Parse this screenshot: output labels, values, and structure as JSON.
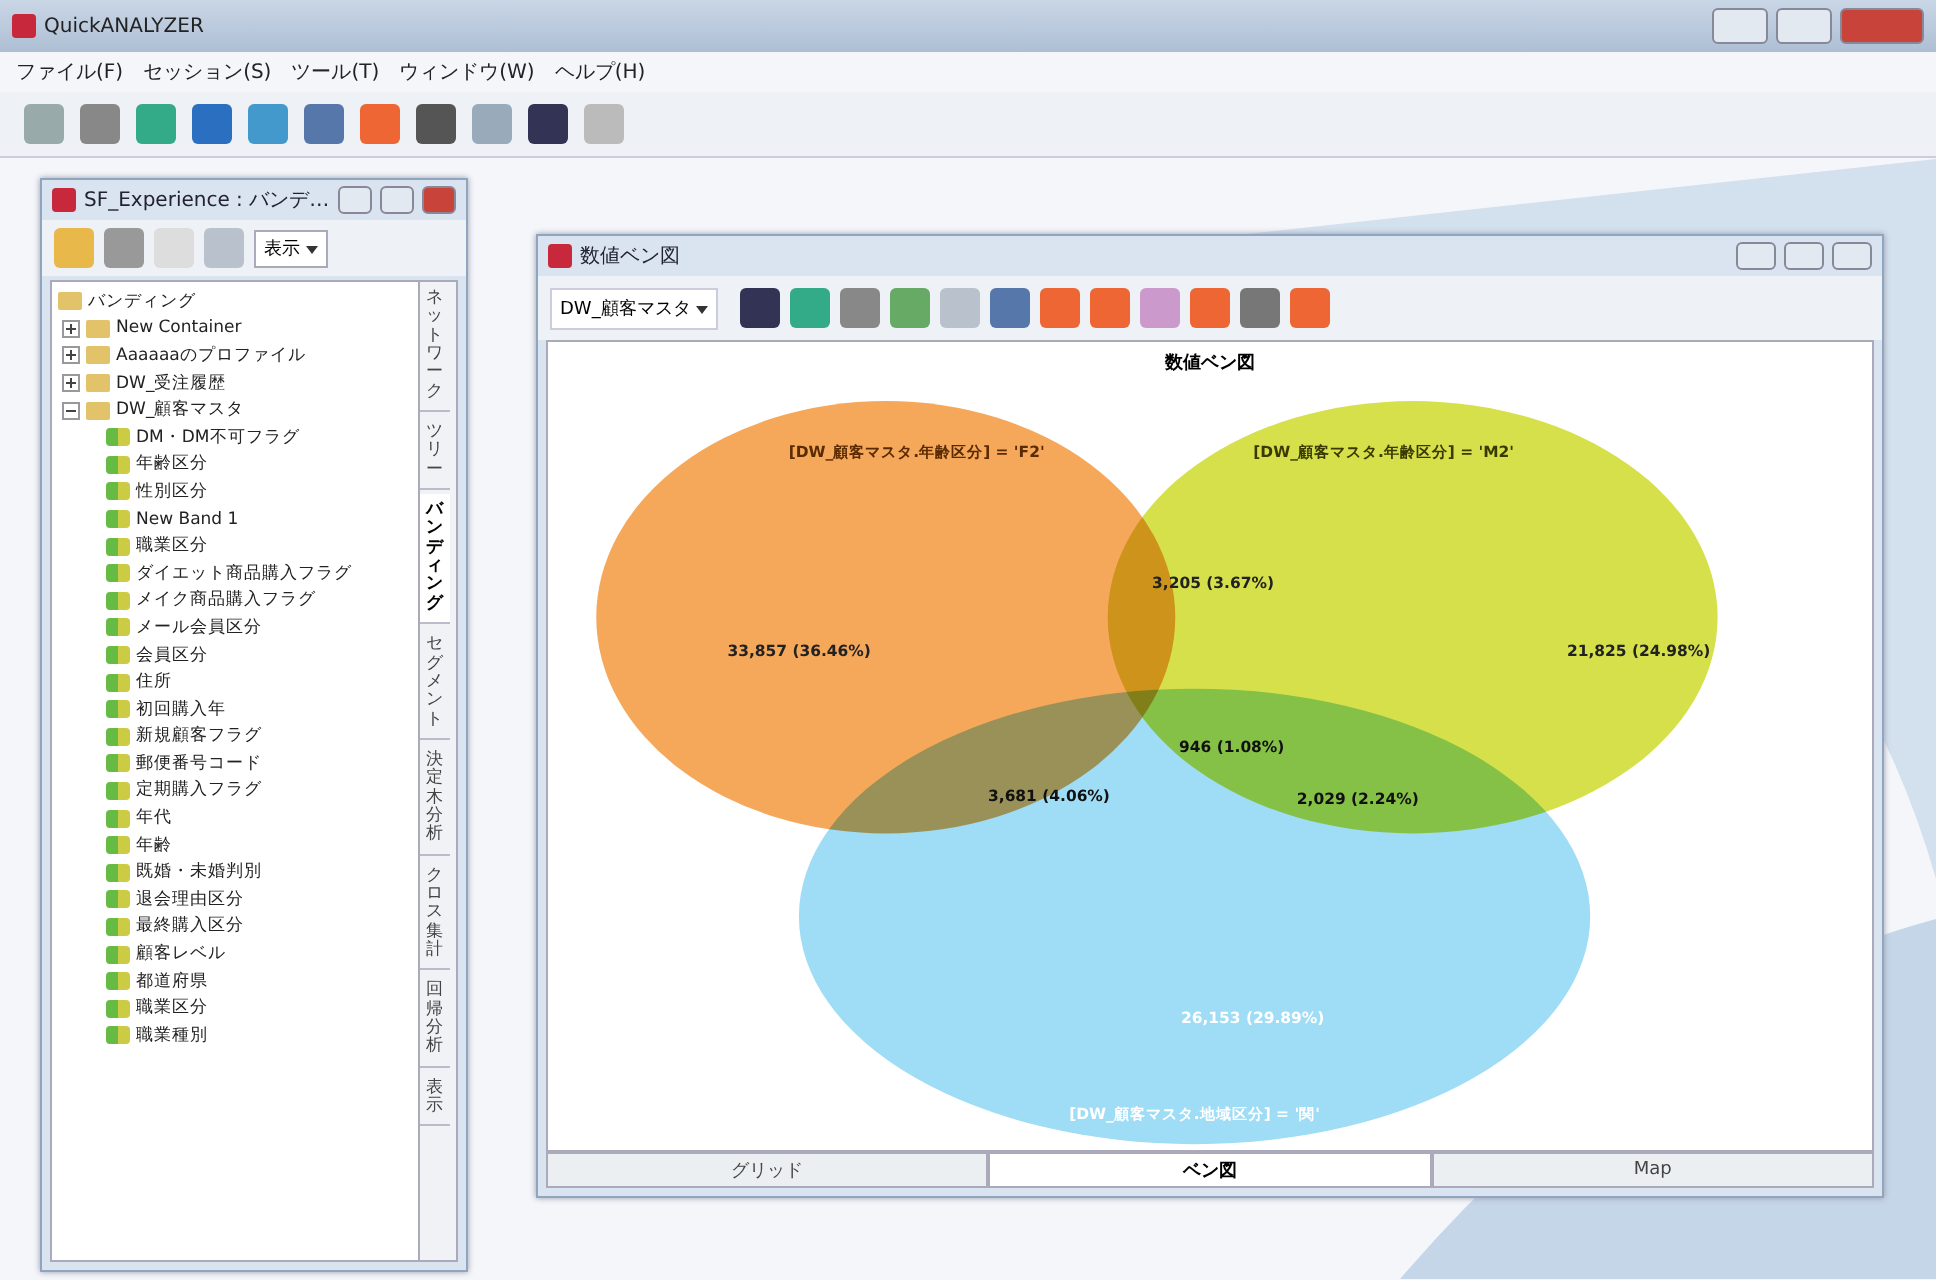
{
  "window": {
    "title": "QuickANALYZER"
  },
  "menu": [
    "ファイル(F)",
    "セッション(S)",
    "ツール(T)",
    "ウィンドウ(W)",
    "ヘルプ(H)"
  ],
  "left_panel": {
    "title": "SF_Experience : バンデ…",
    "view_button": "表示",
    "tree": [
      {
        "label": "バンディング",
        "children": [
          {
            "label": "New Container",
            "expanded": false
          },
          {
            "label": "Aaaaaaのプロファイル",
            "expanded": false
          },
          {
            "label": "DW_受注履歴",
            "expanded": false
          },
          {
            "label": "DW_顧客マスタ",
            "expanded": true,
            "children": [
              {
                "label": "DM・DM不可フラグ"
              },
              {
                "label": "年齢区分"
              },
              {
                "label": "性別区分"
              },
              {
                "label": "New Band 1"
              },
              {
                "label": "職業区分"
              },
              {
                "label": "ダイエット商品購入フラグ"
              },
              {
                "label": "メイク商品購入フラグ"
              },
              {
                "label": "メール会員区分"
              },
              {
                "label": "会員区分"
              },
              {
                "label": "住所"
              },
              {
                "label": "初回購入年"
              },
              {
                "label": "新規顧客フラグ"
              },
              {
                "label": "郵便番号コード"
              },
              {
                "label": "定期購入フラグ"
              },
              {
                "label": "年代"
              },
              {
                "label": "年齢"
              },
              {
                "label": "既婚・未婚判別"
              },
              {
                "label": "退会理由区分"
              },
              {
                "label": "最終購入区分"
              },
              {
                "label": "顧客レベル"
              },
              {
                "label": "都道府県"
              },
              {
                "label": "職業区分"
              },
              {
                "label": "職業種別"
              }
            ]
          }
        ]
      }
    ],
    "side_tabs": [
      {
        "label": "ネットワーク",
        "selected": false
      },
      {
        "label": "ツリー",
        "selected": false
      },
      {
        "label": "バンディング",
        "selected": true
      },
      {
        "label": "セグメント",
        "selected": false
      },
      {
        "label": "決定木分析",
        "selected": false
      },
      {
        "label": "クロス集計",
        "selected": false
      },
      {
        "label": "回帰分析",
        "selected": false
      },
      {
        "label": "表示",
        "selected": false
      }
    ]
  },
  "venn_window": {
    "title": "数値ベン図",
    "source_dropdown": "DW_顧客マスタ",
    "diagram_title": "数値ベン図",
    "sets": [
      {
        "label": "[DW_顧客マスタ.年齢区分] = 'F2'",
        "color": "#f5a85a"
      },
      {
        "label": "[DW_顧客マスタ.年齢区分] = 'M2'",
        "color": "#d6e04a"
      },
      {
        "label": "[DW_顧客マスタ.地域区分] = '関'",
        "color": "#9fdcf5"
      }
    ],
    "regions": [
      {
        "kind": "a",
        "value": "33,857 (36.46%)"
      },
      {
        "kind": "ab",
        "value": "3,205 (3.67%)"
      },
      {
        "kind": "b",
        "value": "21,825 (24.98%)"
      },
      {
        "kind": "ac",
        "value": "3,681 (4.06%)"
      },
      {
        "kind": "abc",
        "value": "946 (1.08%)"
      },
      {
        "kind": "bc",
        "value": "2,029 (2.24%)"
      },
      {
        "kind": "c",
        "value": "26,153 (29.89%)"
      }
    ],
    "tabs": [
      {
        "label": "グリッド",
        "selected": false
      },
      {
        "label": "ベン図",
        "selected": true
      },
      {
        "label": "Map",
        "selected": false
      }
    ]
  }
}
